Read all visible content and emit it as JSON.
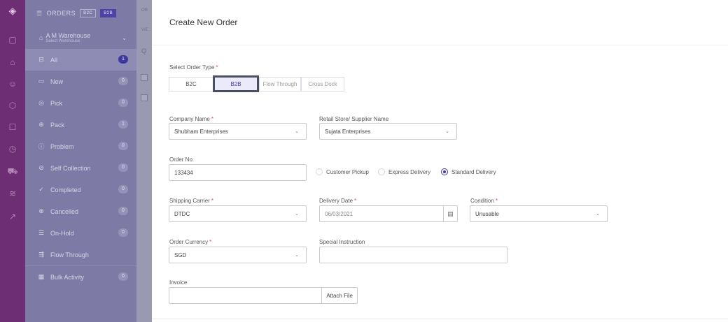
{
  "rail": {
    "icons": [
      "logo-icon",
      "box-icon",
      "home-icon",
      "users-icon",
      "cube-icon",
      "chart-icon",
      "clock-icon",
      "truck-icon",
      "layers-icon",
      "external-icon"
    ]
  },
  "sidebar": {
    "title": "ORDERS",
    "toggle": [
      "B2C",
      "B2B"
    ],
    "warehouse_name": "A M Warehouse",
    "warehouse_sub": "Select Warehouse",
    "items": [
      {
        "label": "All",
        "count": "1"
      },
      {
        "label": "New",
        "count": "0"
      },
      {
        "label": "Pick",
        "count": "0"
      },
      {
        "label": "Pack",
        "count": "1"
      },
      {
        "label": "Problem",
        "count": "0"
      },
      {
        "label": "Self Collection",
        "count": "0"
      },
      {
        "label": "Completed",
        "count": "0"
      },
      {
        "label": "Cancelled",
        "count": "0"
      },
      {
        "label": "On-Hold",
        "count": "0"
      },
      {
        "label": "Flow Through",
        "count": ""
      },
      {
        "label": "Bulk Activity",
        "count": "0"
      }
    ]
  },
  "bg_list": {
    "top_text": "OR",
    "sub_text": "VIE"
  },
  "form": {
    "title": "Create New Order",
    "order_type_label": "Select Order Type",
    "order_types": [
      "B2C",
      "B2B",
      "Flow Through",
      "Cross Dock"
    ],
    "selected_order_type": "B2B",
    "company_label": "Company Name",
    "company_value": "Shubham Enterprises",
    "retail_label": "Retail Store/ Supplier Name",
    "retail_value": "Sujata Enterprises",
    "order_no_label": "Order No.",
    "order_no_value": "133434",
    "delivery_options": [
      "Customer Pickup",
      "Express Delivery",
      "Standard Delivery"
    ],
    "selected_delivery": "Standard Delivery",
    "carrier_label": "Shipping Carrier",
    "carrier_value": "DTDC",
    "date_label": "Delivery Date",
    "date_value": "06/03/2021",
    "condition_label": "Condition",
    "condition_value": "Unusable",
    "currency_label": "Order Currency",
    "currency_value": "SGD",
    "instruction_label": "Special Instruction",
    "instruction_value": "",
    "invoice_label": "Invoice",
    "attach_label": "Attach File"
  },
  "colors": {
    "accent": "#3f38a0",
    "rail": "#6e2e73",
    "required": "#ee4444"
  }
}
